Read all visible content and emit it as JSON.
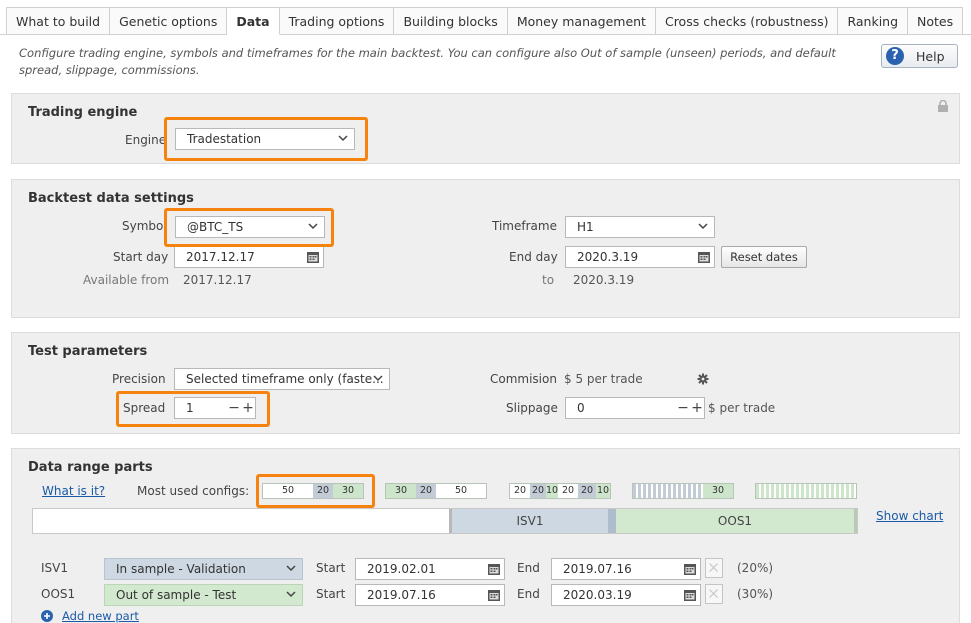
{
  "tabs": [
    "What to build",
    "Genetic options",
    "Data",
    "Trading options",
    "Building blocks",
    "Money management",
    "Cross checks (robustness)",
    "Ranking",
    "Notes"
  ],
  "active_tab": "Data",
  "description": "Configure trading engine, symbols and timeframes for the main backtest. You can configure also Out of sample (unseen) periods, and default spread, slippage, commissions.",
  "help_label": "Help",
  "trading_engine": {
    "title": "Trading engine",
    "engine_label": "Engine",
    "engine_value": "Tradestation"
  },
  "backtest": {
    "title": "Backtest data settings",
    "symbol_label": "Symbol",
    "symbol_value": "@BTC_TS",
    "timeframe_label": "Timeframe",
    "timeframe_value": "H1",
    "start_label": "Start day",
    "start_value": "2017.12.17",
    "end_label": "End day",
    "end_value": "2020.3.19",
    "reset_label": "Reset dates",
    "available_label": "Available from",
    "available_from": "2017.12.17",
    "to_label": "to",
    "available_to": "2020.3.19"
  },
  "test_params": {
    "title": "Test parameters",
    "precision_label": "Precision",
    "precision_value": "Selected timeframe only (faste...",
    "commission_label": "Commision",
    "commission_value": "$ 5 per trade",
    "spread_label": "Spread",
    "spread_value": "1",
    "slippage_label": "Slippage",
    "slippage_value": "0",
    "slippage_unit": "$ per trade"
  },
  "data_range": {
    "title": "Data range parts",
    "what_link": "What is it?",
    "most_used_label": "Most used configs:",
    "configs": [
      [
        "50",
        "20",
        "30"
      ],
      [
        "30",
        "20",
        "50"
      ],
      [
        "20",
        "20",
        "10",
        "20",
        "20",
        "10"
      ],
      [
        "",
        "",
        "",
        "30"
      ],
      [
        "",
        "",
        "",
        "",
        ""
      ]
    ],
    "show_chart": "Show chart",
    "chart": {
      "isv": "ISV1",
      "oos": "OOS1"
    },
    "parts": [
      {
        "name": "ISV1",
        "type": "In sample - Validation",
        "start_label": "Start",
        "start": "2019.02.01",
        "end_label": "End",
        "end": "2019.07.16",
        "pct": "(20%)"
      },
      {
        "name": "OOS1",
        "type": "Out of sample - Test",
        "start_label": "Start",
        "start": "2019.07.16",
        "end_label": "End",
        "end": "2020.03.19",
        "pct": "(30%)"
      }
    ],
    "add_part": "Add new part"
  },
  "colors": {
    "highlight": "#f7830f",
    "link": "#1a5aa8",
    "isv": "#cdd8e3",
    "oos": "#d2e8cf"
  }
}
